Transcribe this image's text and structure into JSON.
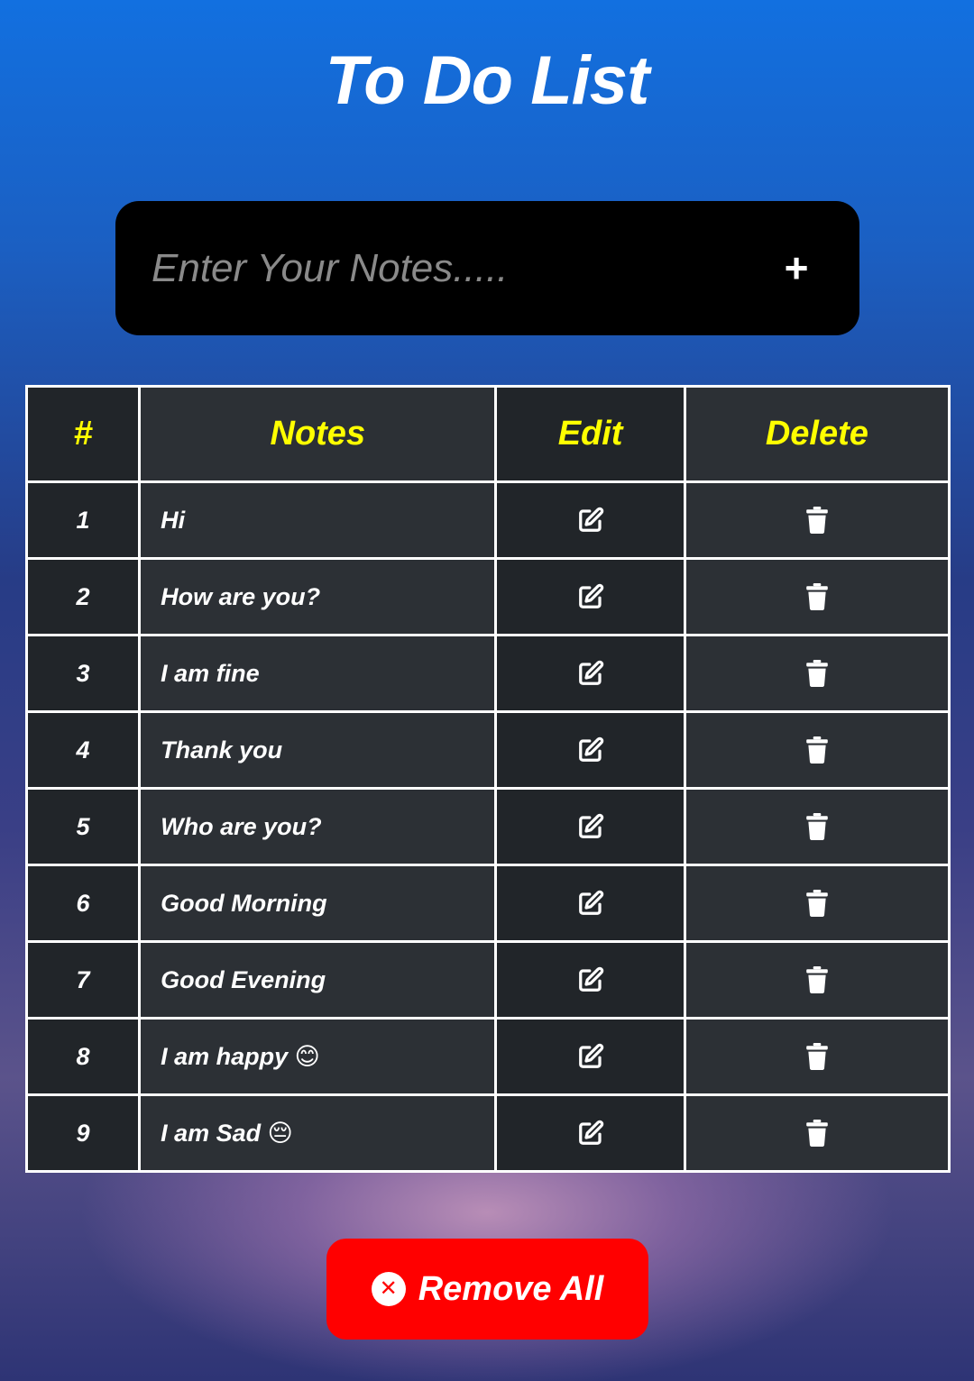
{
  "header": {
    "title": "To Do List"
  },
  "input": {
    "placeholder": "Enter Your Notes.....",
    "value": "",
    "add_label": "+"
  },
  "table": {
    "headers": {
      "number": "#",
      "notes": "Notes",
      "edit": "Edit",
      "delete": "Delete"
    },
    "rows": [
      {
        "num": "1",
        "note": "Hi"
      },
      {
        "num": "2",
        "note": "How are you?"
      },
      {
        "num": "3",
        "note": "I am fine"
      },
      {
        "num": "4",
        "note": "Thank you"
      },
      {
        "num": "5",
        "note": "Who are you?"
      },
      {
        "num": "6",
        "note": "Good Morning"
      },
      {
        "num": "7",
        "note": "Good Evening"
      },
      {
        "num": "8",
        "note": "I am happy 😊"
      },
      {
        "num": "9",
        "note": "I am Sad 😔"
      }
    ],
    "edit_icon": "edit-icon",
    "delete_icon": "trash-icon"
  },
  "footer": {
    "remove_all_label": "Remove All",
    "remove_all_icon": "x-circle-icon"
  },
  "colors": {
    "header_text": "#ffff00",
    "remove_button": "#ff0000",
    "input_background": "#000000",
    "table_cell_dark": "#212529",
    "table_cell_mid": "#2c3035"
  }
}
